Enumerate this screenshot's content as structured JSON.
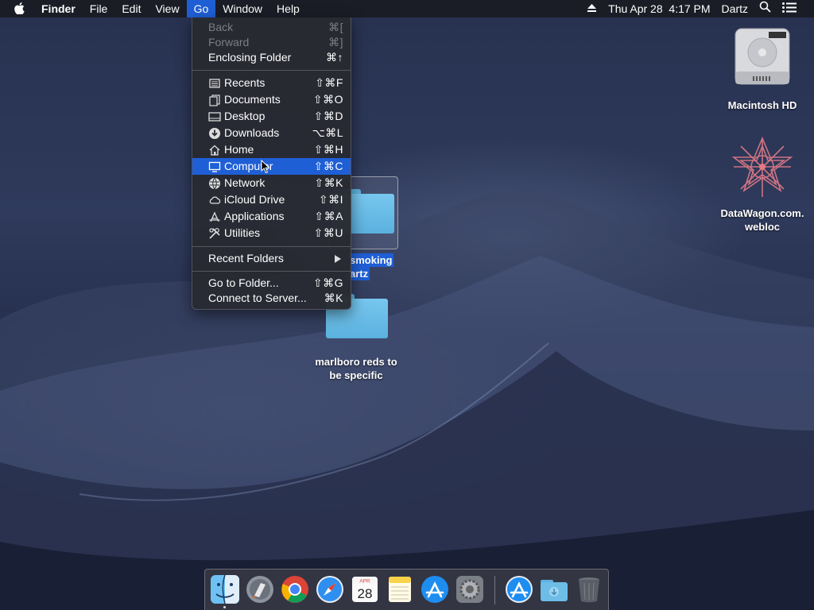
{
  "menubar": {
    "app": "Finder",
    "items": [
      "File",
      "Edit",
      "View",
      "Go",
      "Window",
      "Help"
    ],
    "active": "Go",
    "clock": "Thu Apr 28  4:17 PM",
    "user": "Dartz"
  },
  "go_menu": {
    "back": {
      "label": "Back",
      "shortcut": "⌘["
    },
    "forward": {
      "label": "Forward",
      "shortcut": "⌘]"
    },
    "enclosing": {
      "label": "Enclosing Folder",
      "shortcut": "⌘↑"
    },
    "places": [
      {
        "label": "Recents",
        "shortcut": "⇧⌘F",
        "icon": "recents-icon"
      },
      {
        "label": "Documents",
        "shortcut": "⇧⌘O",
        "icon": "documents-icon"
      },
      {
        "label": "Desktop",
        "shortcut": "⇧⌘D",
        "icon": "desktop-icon"
      },
      {
        "label": "Downloads",
        "shortcut": "⌥⌘L",
        "icon": "downloads-icon"
      },
      {
        "label": "Home",
        "shortcut": "⇧⌘H",
        "icon": "home-icon"
      },
      {
        "label": "Computer",
        "shortcut": "⇧⌘C",
        "icon": "computer-icon"
      },
      {
        "label": "Network",
        "shortcut": "⇧⌘K",
        "icon": "network-icon"
      },
      {
        "label": "iCloud Drive",
        "shortcut": "⇧⌘I",
        "icon": "icloud-icon"
      },
      {
        "label": "Applications",
        "shortcut": "⇧⌘A",
        "icon": "applications-icon"
      },
      {
        "label": "Utilities",
        "shortcut": "⇧⌘U",
        "icon": "utilities-icon"
      }
    ],
    "highlighted": "Computer",
    "recent_folders": "Recent Folders",
    "go_to_folder": {
      "label": "Go to Folder...",
      "shortcut": "⇧⌘G"
    },
    "connect": {
      "label": "Connect to Server...",
      "shortcut": "⌘K"
    }
  },
  "desktop": {
    "drive": "Macintosh HD",
    "webloc_line1": "DataWagon.com.",
    "webloc_line2": "webloc",
    "folder1_line1": "smoking",
    "folder1_line2": "artz",
    "folder2_line1": "marlboro reds to",
    "folder2_line2": "be specific"
  },
  "dock": {
    "apps": [
      "finder-icon",
      "launchpad-icon",
      "chrome-icon",
      "safari-icon",
      "calendar-icon",
      "notes-icon",
      "app-store-icon",
      "system-preferences-icon",
      "app-store-icon",
      "downloads-folder-icon",
      "trash-icon"
    ],
    "calendar": {
      "month": "APR",
      "day": "28"
    }
  },
  "colors": {
    "selection": "#1f5fd6",
    "folder": "#6bbde8"
  }
}
